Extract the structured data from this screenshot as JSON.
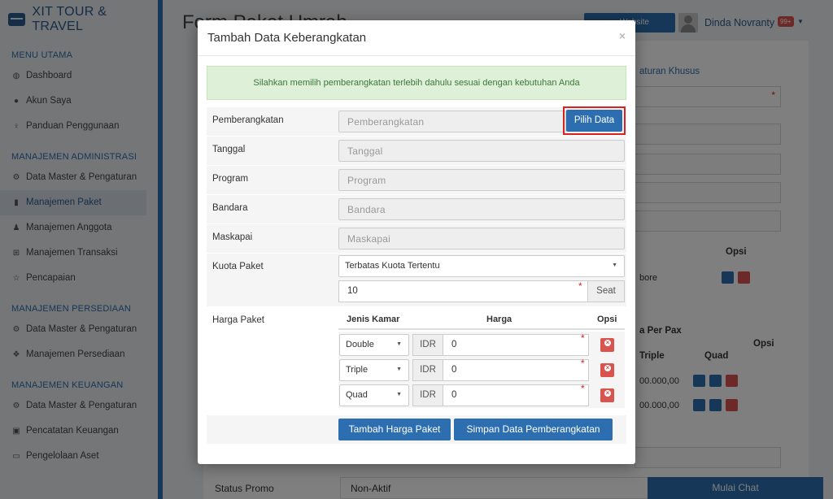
{
  "sidebar": {
    "brand": "XIT TOUR & TRAVEL",
    "sections": [
      {
        "title": "MENU UTAMA",
        "items": [
          {
            "label": "Dashboard",
            "icon": "dashboard-icon"
          },
          {
            "label": "Akun Saya",
            "icon": "user-icon"
          },
          {
            "label": "Panduan Penggunaan",
            "icon": "bulb-icon"
          }
        ]
      },
      {
        "title": "MANAJEMEN ADMINISTRASI",
        "items": [
          {
            "label": "Data Master & Pengaturan",
            "icon": "cogs-icon"
          },
          {
            "label": "Manajemen Paket",
            "icon": "book-icon"
          },
          {
            "label": "Manajemen Anggota",
            "icon": "users-icon"
          },
          {
            "label": "Manajemen Transaksi",
            "icon": "cart-icon"
          },
          {
            "label": "Pencapaian",
            "icon": "star-icon"
          }
        ]
      },
      {
        "title": "MANAJEMEN PERSEDIAAN",
        "items": [
          {
            "label": "Data Master & Pengaturan",
            "icon": "cogs-icon"
          },
          {
            "label": "Manajemen Persediaan",
            "icon": "cubes-icon"
          }
        ]
      },
      {
        "title": "MANAJEMEN KEUANGAN",
        "items": [
          {
            "label": "Data Master & Pengaturan",
            "icon": "cogs-icon"
          },
          {
            "label": "Pencatatan Keuangan",
            "icon": "money-icon"
          },
          {
            "label": "Pengelolaan Aset",
            "icon": "drive-icon"
          }
        ]
      }
    ]
  },
  "header": {
    "page_title": "Form Paket Umrah",
    "website_btn": "Website",
    "user_name": "Dinda Novranty",
    "notif_badge": "99+"
  },
  "background": {
    "tab_label": "aturan Khusus",
    "opsi": "Opsi",
    "harga_per_pax": "a Per Pax",
    "triple": "Triple",
    "quad": "Quad",
    "row_val_1": "bore",
    "price_1": "00.000,00",
    "price_2": "00.000,00",
    "status_label": "Status Promo",
    "status_value": "Non-Aktif",
    "chat_button": "Mulai Chat"
  },
  "modal": {
    "title": "Tambah Data Keberangkatan",
    "close": "×",
    "alert": "Silahkan memilih pemberangkatan terlebih dahulu sesuai dengan kebutuhan Anda",
    "fields": {
      "pemberangkatan": {
        "label": "Pemberangkatan",
        "placeholder": "Pemberangkatan"
      },
      "tanggal": {
        "label": "Tanggal",
        "placeholder": "Tanggal"
      },
      "program": {
        "label": "Program",
        "placeholder": "Program"
      },
      "bandara": {
        "label": "Bandara",
        "placeholder": "Bandara"
      },
      "maskapai": {
        "label": "Maskapai",
        "placeholder": "Maskapai"
      }
    },
    "pilih_button": "Pilih Data",
    "kuota": {
      "label": "Kuota Paket",
      "select_value": "Terbatas Kuota Tertentu",
      "value": "10",
      "unit": "Seat"
    },
    "harga": {
      "label": "Harga Paket",
      "col_jenis": "Jenis Kamar",
      "col_harga": "Harga",
      "col_opsi": "Opsi",
      "currency": "IDR",
      "rows": [
        {
          "jenis": "Double",
          "harga": "0"
        },
        {
          "jenis": "Triple",
          "harga": "0"
        },
        {
          "jenis": "Quad",
          "harga": "0"
        }
      ]
    },
    "buttons": {
      "tambah": "Tambah Harga Paket",
      "simpan": "Simpan Data Pemberangkatan"
    }
  }
}
